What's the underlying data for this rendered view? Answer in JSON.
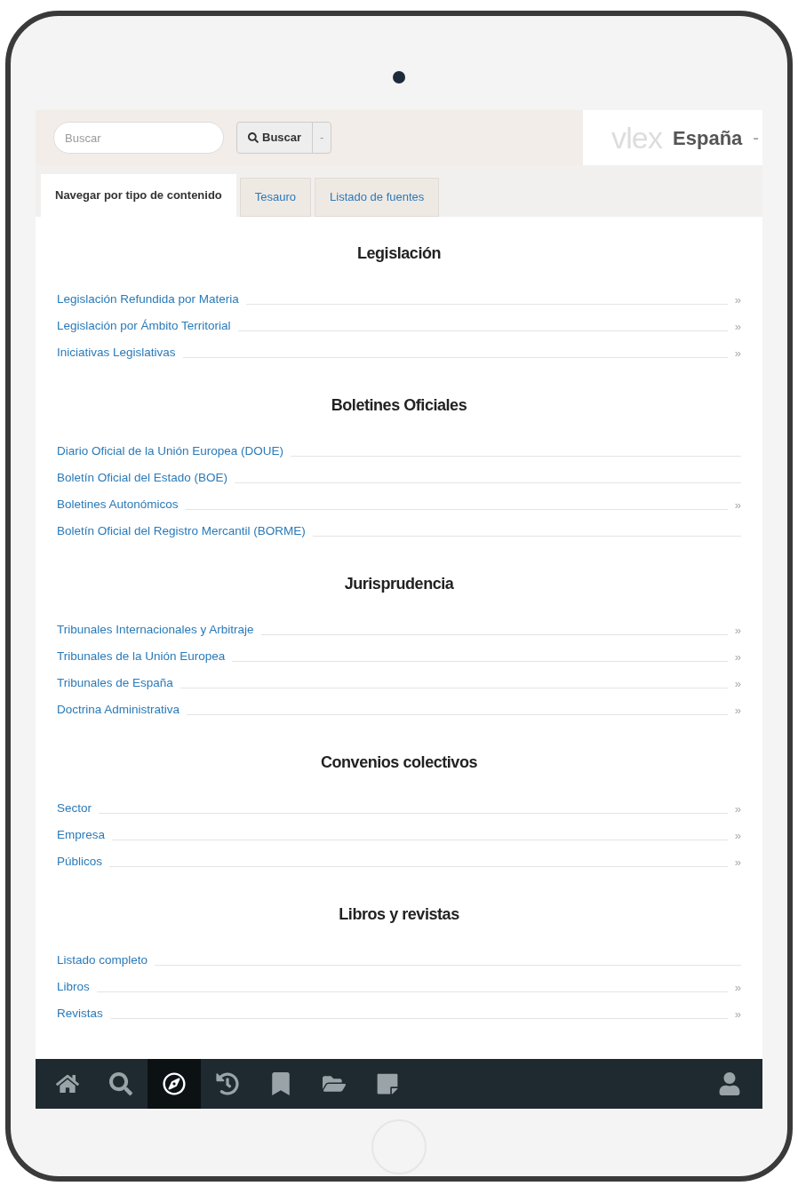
{
  "search": {
    "placeholder": "Buscar",
    "button": "Buscar",
    "dropdown": "-"
  },
  "brand": {
    "logo": "vlex",
    "country": "España",
    "caret": "-"
  },
  "tabs": [
    {
      "label": "Navegar por tipo de contenido",
      "selected": true
    },
    {
      "label": "Tesauro",
      "selected": false
    },
    {
      "label": "Listado de fuentes",
      "selected": false
    }
  ],
  "sections": [
    {
      "title": "Legislación",
      "items": [
        {
          "label": "Legislación Refundida por Materia",
          "more": "»"
        },
        {
          "label": "Legislación por Ámbito Territorial",
          "more": "»"
        },
        {
          "label": "Iniciativas Legislativas",
          "more": "»"
        }
      ]
    },
    {
      "title": "Boletines Oficiales",
      "items": [
        {
          "label": "Diario Oficial de la Unión Europea (DOUE)"
        },
        {
          "label": "Boletín Oficial del Estado (BOE)"
        },
        {
          "label": "Boletines Autonómicos",
          "more": "»"
        },
        {
          "label": "Boletín Oficial del Registro Mercantil (BORME)"
        }
      ]
    },
    {
      "title": "Jurisprudencia",
      "items": [
        {
          "label": "Tribunales Internacionales y Arbitraje",
          "more": "»"
        },
        {
          "label": "Tribunales de la Unión Europea",
          "more": "»"
        },
        {
          "label": "Tribunales de España",
          "more": "»"
        },
        {
          "label": "Doctrina Administrativa",
          "more": "»"
        }
      ]
    },
    {
      "title": "Convenios colectivos",
      "items": [
        {
          "label": "Sector",
          "more": "»"
        },
        {
          "label": "Empresa",
          "more": "»"
        },
        {
          "label": "Públicos",
          "more": "»"
        }
      ]
    },
    {
      "title": "Libros y revistas",
      "items": [
        {
          "label": "Listado completo"
        },
        {
          "label": "Libros",
          "more": "»"
        },
        {
          "label": "Revistas",
          "more": "»"
        }
      ]
    }
  ],
  "toolbar": [
    {
      "kind": "home",
      "selected": false
    },
    {
      "kind": "search",
      "selected": false
    },
    {
      "kind": "compass",
      "selected": true
    },
    {
      "kind": "clock",
      "selected": false
    },
    {
      "kind": "bookmark",
      "selected": false
    },
    {
      "kind": "folder",
      "selected": false
    },
    {
      "kind": "note",
      "selected": false
    }
  ]
}
